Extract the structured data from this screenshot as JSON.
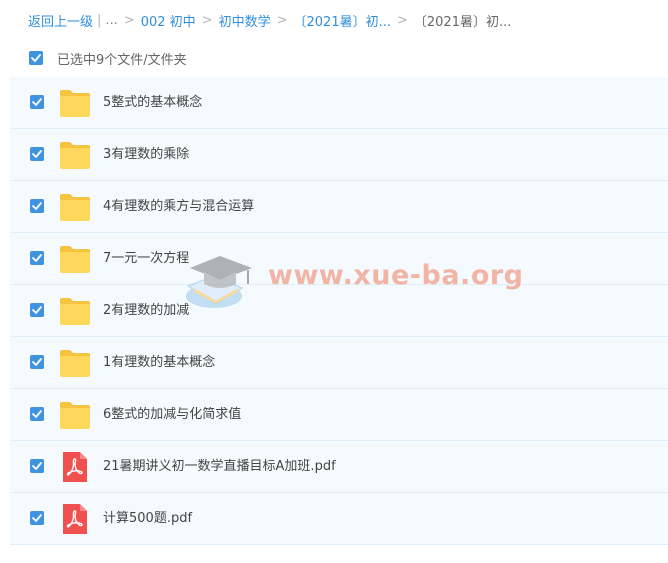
{
  "breadcrumb": {
    "back": "返回上一级",
    "pipe": "|",
    "ellipsis": "...",
    "sep": ">",
    "items": [
      "002 初中",
      "初中数学",
      "〔2021暑〕初..."
    ],
    "current": "〔2021暑〕初..."
  },
  "selection": {
    "label": "已选中9个文件/文件夹",
    "checked": true
  },
  "files": [
    {
      "name": "5整式的基本概念",
      "type": "folder",
      "checked": true
    },
    {
      "name": "3有理数的乘除",
      "type": "folder",
      "checked": true
    },
    {
      "name": "4有理数的乘方与混合运算",
      "type": "folder",
      "checked": true
    },
    {
      "name": "7一元一次方程",
      "type": "folder",
      "checked": true
    },
    {
      "name": "2有理数的加减",
      "type": "folder",
      "checked": true
    },
    {
      "name": "1有理数的基本概念",
      "type": "folder",
      "checked": true
    },
    {
      "name": "6整式的加减与化简求值",
      "type": "folder",
      "checked": true
    },
    {
      "name": "21暑期讲义初一数学直播目标A加班.pdf",
      "type": "pdf",
      "checked": true
    },
    {
      "name": "计算500题.pdf",
      "type": "pdf",
      "checked": true
    }
  ],
  "icons": {
    "folder": "folder-icon",
    "pdf": "pdf-icon",
    "check": "check-icon"
  },
  "colors": {
    "link": "#2f8fdd",
    "checkbox": "#3f94e0",
    "row_bg": "#f4fafe",
    "row_border": "#deedf8",
    "folder": "#ffd75a",
    "pdf": "#f0504f",
    "watermark": "#f2a390"
  },
  "watermark": {
    "text": "www.xue-ba.org"
  }
}
